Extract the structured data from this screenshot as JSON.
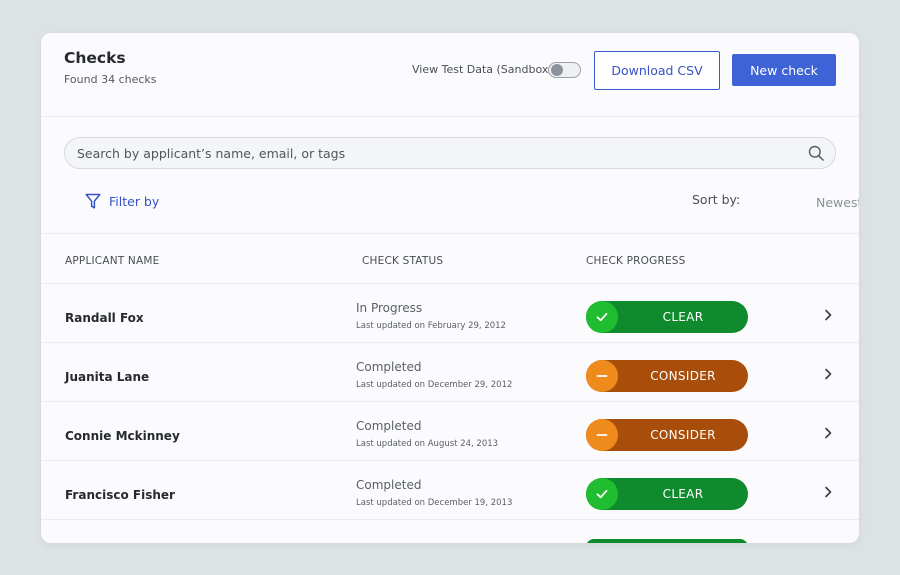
{
  "header": {
    "title": "Checks",
    "subtitle": "Found 34 checks",
    "sandbox_label": "View Test Data (Sandbox)",
    "sandbox_enabled": false,
    "download_label": "Download CSV",
    "new_check_label": "New check"
  },
  "search": {
    "placeholder": "Search by applicant’s name, email, or tags",
    "icon": "search-icon"
  },
  "filter": {
    "label": "Filter by",
    "icon": "filter-icon"
  },
  "sort": {
    "label": "Sort by:",
    "value": "Newest"
  },
  "table": {
    "columns": [
      "APPLICANT NAME",
      "CHECK STATUS",
      "CHECK PROGRESS"
    ],
    "rows": [
      {
        "name": "Randall Fox",
        "status": "In Progress",
        "updated": "Last updated on February 29, 2012",
        "progress": "CLEAR",
        "kind": "clear"
      },
      {
        "name": "Juanita Lane",
        "status": "Completed",
        "updated": "Last updated on December 29, 2012",
        "progress": "CONSIDER",
        "kind": "consider"
      },
      {
        "name": "Connie Mckinney",
        "status": "Completed",
        "updated": "Last updated on August 24, 2013",
        "progress": "CONSIDER",
        "kind": "consider"
      },
      {
        "name": "Francisco Fisher",
        "status": "Completed",
        "updated": "Last updated on December 19, 2013",
        "progress": "CLEAR",
        "kind": "clear"
      }
    ]
  },
  "colors": {
    "accent": "#3d63d6",
    "clear_bg": "#0f8a2c",
    "clear_icon": "#1fbd2f",
    "consider_bg": "#a84e0a",
    "consider_icon": "#ef8a1c"
  }
}
